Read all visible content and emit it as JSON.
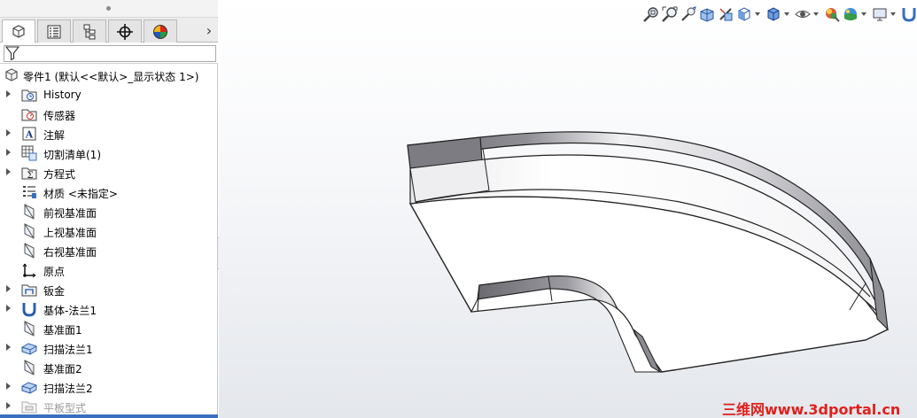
{
  "feature_manager": {
    "tabs": [
      {
        "name": "featuremanager-tab",
        "icon": "feature-tree-icon",
        "active": true
      },
      {
        "name": "propertymanager-tab",
        "icon": "property-manager-icon",
        "active": false
      },
      {
        "name": "configurationmanager-tab",
        "icon": "configuration-manager-icon",
        "active": false
      },
      {
        "name": "dimxpertmanager-tab",
        "icon": "dimxpert-icon",
        "active": false
      },
      {
        "name": "displaymanager-tab",
        "icon": "display-manager-icon",
        "active": false
      }
    ],
    "more_tabs_glyph": "›",
    "root": {
      "label": "零件1  (默认<<默认>_显示状态 1>)",
      "icon": "part-icon"
    },
    "items": [
      {
        "label": "History",
        "icon": "history-folder-icon",
        "expandable": true
      },
      {
        "label": "传感器",
        "icon": "sensor-folder-icon",
        "expandable": false
      },
      {
        "label": "注解",
        "icon": "annotations-icon",
        "expandable": true
      },
      {
        "label": "切割清单(1)",
        "icon": "cut-list-icon",
        "expandable": true
      },
      {
        "label": "方程式",
        "icon": "equations-icon",
        "expandable": true
      },
      {
        "label": "材质 <未指定>",
        "icon": "material-icon",
        "expandable": false
      },
      {
        "label": "前视基准面",
        "icon": "plane-icon",
        "expandable": false
      },
      {
        "label": "上视基准面",
        "icon": "plane-icon",
        "expandable": false
      },
      {
        "label": "右视基准面",
        "icon": "plane-icon",
        "expandable": false
      },
      {
        "label": "原点",
        "icon": "origin-icon",
        "expandable": false
      },
      {
        "label": "钣金",
        "icon": "sheet-metal-folder-icon",
        "expandable": true
      },
      {
        "label": "基体-法兰1",
        "icon": "base-flange-icon",
        "expandable": true
      },
      {
        "label": "基准面1",
        "icon": "plane-icon",
        "expandable": false
      },
      {
        "label": "扫描法兰1",
        "icon": "swept-flange-icon",
        "expandable": true
      },
      {
        "label": "基准面2",
        "icon": "plane-icon",
        "expandable": false
      },
      {
        "label": "扫描法兰2",
        "icon": "swept-flange-icon",
        "expandable": true
      },
      {
        "label": "平板型式",
        "icon": "flat-pattern-icon",
        "expandable": true,
        "suppressed": true
      }
    ]
  },
  "heads_up_toolbar": [
    "zoom-to-fit-icon",
    "zoom-to-area-icon",
    "previous-view-icon",
    "section-view-icon",
    "dynamic-annotation-icon",
    "view-orientation-icon",
    "display-style-icon",
    "hide-show-items-icon",
    "edit-appearance-icon",
    "apply-scene-icon",
    "view-settings-icon",
    "base-flange-tool-icon",
    "sheet-metal-tool-icon",
    "flatten-icon",
    "fold-icon",
    "no-bends-icon",
    "sketched-bend-icon",
    "jog-icon"
  ],
  "watermark": "三维网www.3dportal.cn",
  "colors": {
    "accent": "#3a6fbf",
    "watermark": "#e0201c"
  }
}
